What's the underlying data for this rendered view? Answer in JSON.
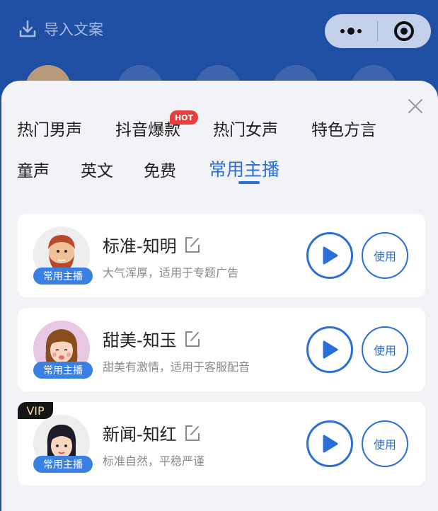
{
  "header": {
    "import_label": "导入文案"
  },
  "sheet": {
    "tabs": [
      {
        "label": "热门男声"
      },
      {
        "label": "抖音爆款",
        "badge": "HOT"
      },
      {
        "label": "热门女声"
      },
      {
        "label": "特色方言"
      },
      {
        "label": "童声"
      },
      {
        "label": "英文"
      },
      {
        "label": "免费"
      },
      {
        "label": "常用主播",
        "active": true
      }
    ],
    "voices": [
      {
        "name": "标准-知明",
        "desc": "大气浑厚，适用于专题广告",
        "tag": "常用主播",
        "use_label": "使用",
        "avatar": "bearded-man"
      },
      {
        "name": "甜美-知玉",
        "desc": "甜美有激情，适用于客服配音",
        "tag": "常用主播",
        "use_label": "使用",
        "avatar": "smiling-girl"
      },
      {
        "name": "新闻-知红",
        "desc": "标准自然，平稳严谨",
        "tag": "常用主播",
        "use_label": "使用",
        "vip": "VIP",
        "avatar": "short-hair-woman"
      }
    ]
  },
  "colors": {
    "brand_blue": "#1f4fa3",
    "accent": "#2a6ed8",
    "hot": "#e73e3e"
  }
}
